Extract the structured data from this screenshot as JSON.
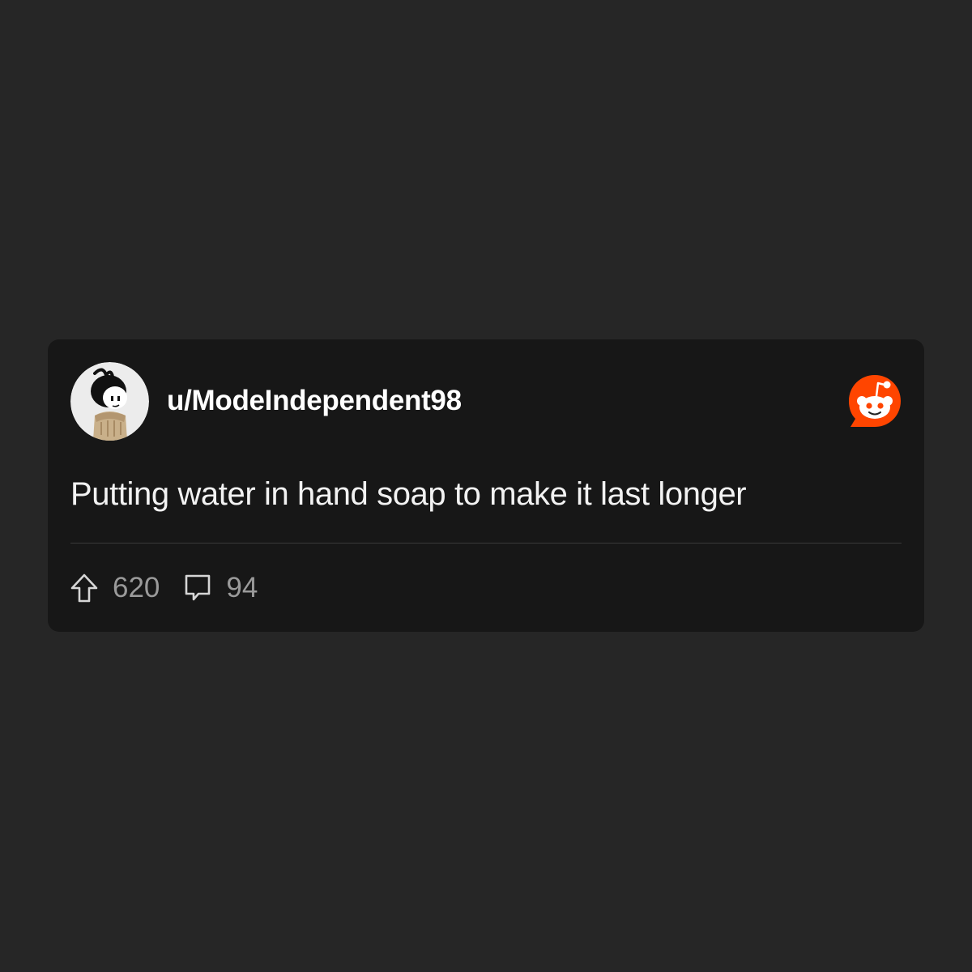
{
  "post": {
    "author": "u/ModeIndependent98",
    "title": "Putting water in hand soap to make it last longer",
    "upvotes": "620",
    "comments": "94"
  },
  "icons": {
    "avatar": "user-avatar-snoo",
    "logo": "reddit-logo-icon",
    "upvote": "upvote-arrow-icon",
    "comment": "comment-bubble-icon"
  },
  "colors": {
    "background": "#262626",
    "card": "#171717",
    "brand": "#ff4500",
    "text_primary": "#ffffff",
    "text_muted": "#9a9a9a"
  }
}
